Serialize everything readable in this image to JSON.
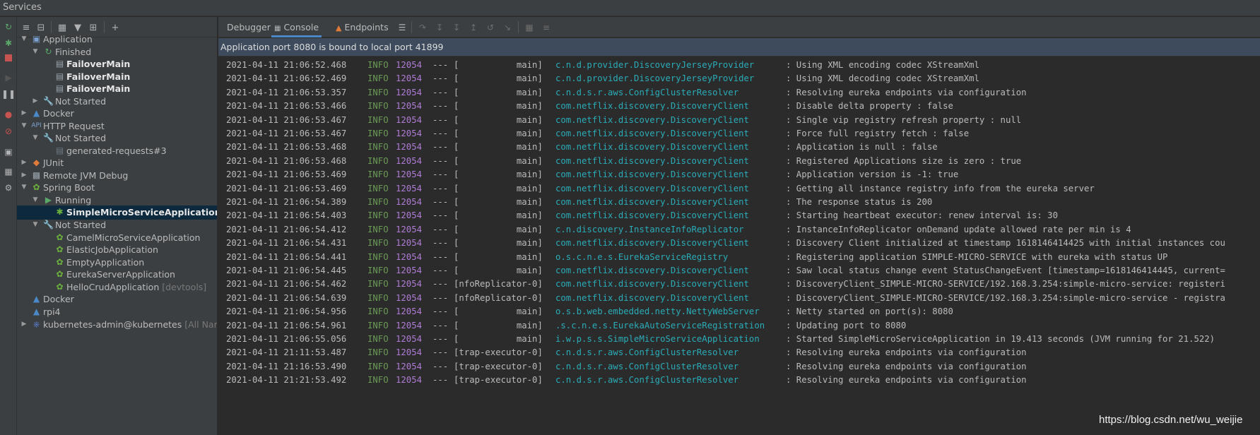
{
  "window": {
    "title": "Services"
  },
  "colors": {
    "accent": "#4a88c7",
    "selected_row": "#0d293e",
    "banner_bg": "#3d4b5c",
    "log_info": "#6a9955",
    "log_pid": "#b07cd6",
    "log_logger": "#2aacb8",
    "run_green": "#59a869",
    "stop_red": "#c75450"
  },
  "left_toolbar": {
    "icons": [
      "rerun-icon",
      "debug-icon",
      "stop-icon",
      "resume-icon",
      "pause-icon",
      "breakpoint-icon",
      "mute-breakpoints-icon",
      "camera-icon",
      "layout-icon",
      "settings-icon"
    ]
  },
  "tree_toolbar": {
    "icons": [
      "expand-all-icon",
      "collapse-all-icon",
      "group-icon",
      "filter-icon",
      "new-tab-icon",
      "add-service-icon"
    ]
  },
  "tree": {
    "items": [
      {
        "label": "Application",
        "suffix": "",
        "bold": false,
        "icon": "application-icon"
      },
      {
        "label": "Finished",
        "suffix": "",
        "bold": false,
        "icon": "finished-icon"
      },
      {
        "label": "FailoverMain",
        "suffix": "",
        "bold": true,
        "icon": "class-icon"
      },
      {
        "label": "FailoverMain",
        "suffix": "",
        "bold": true,
        "icon": "class-icon"
      },
      {
        "label": "FailoverMain",
        "suffix": "",
        "bold": true,
        "icon": "class-icon"
      },
      {
        "label": "Not Started",
        "suffix": "",
        "bold": false,
        "icon": "wrench-icon"
      },
      {
        "label": "Docker",
        "suffix": "",
        "bold": false,
        "icon": "docker-icon"
      },
      {
        "label": "HTTP Request",
        "suffix": "",
        "bold": false,
        "icon": "api-icon"
      },
      {
        "label": "Not Started",
        "suffix": "",
        "bold": false,
        "icon": "wrench-icon"
      },
      {
        "label": "generated-requests#3",
        "suffix": "",
        "bold": false,
        "icon": "http-file-icon"
      },
      {
        "label": "JUnit",
        "suffix": "",
        "bold": false,
        "icon": "junit-icon"
      },
      {
        "label": "Remote JVM Debug",
        "suffix": "",
        "bold": false,
        "icon": "remote-debug-icon"
      },
      {
        "label": "Spring Boot",
        "suffix": "",
        "bold": false,
        "icon": "spring-boot-icon"
      },
      {
        "label": "Running",
        "suffix": "",
        "bold": false,
        "icon": "running-icon"
      },
      {
        "label": "SimpleMicroServiceApplication",
        "suffix": "",
        "bold": true,
        "icon": "spring-debug-icon"
      },
      {
        "label": "Not Started",
        "suffix": "",
        "bold": false,
        "icon": "wrench-icon"
      },
      {
        "label": "CamelMicroServiceApplication",
        "suffix": "",
        "bold": false,
        "icon": "spring-leaf-icon"
      },
      {
        "label": "ElasticJobApplication",
        "suffix": "",
        "bold": false,
        "icon": "spring-leaf-icon"
      },
      {
        "label": "EmptyApplication",
        "suffix": "",
        "bold": false,
        "icon": "spring-leaf-icon"
      },
      {
        "label": "EurekaServerApplication",
        "suffix": "",
        "bold": false,
        "icon": "spring-leaf-icon"
      },
      {
        "label": "HelloCrudApplication",
        "suffix": " [devtools]",
        "bold": false,
        "icon": "spring-leaf-icon"
      },
      {
        "label": "Docker",
        "suffix": "",
        "bold": false,
        "icon": "docker-icon"
      },
      {
        "label": "rpi4",
        "suffix": "",
        "bold": false,
        "icon": "docker-icon"
      },
      {
        "label": "kubernetes-admin@kubernetes",
        "suffix": " [All Nam",
        "bold": false,
        "icon": "kubernetes-icon"
      }
    ]
  },
  "content_toolbar": {
    "tabs": [
      {
        "label": "Debugger",
        "icon": ""
      },
      {
        "label": "Console",
        "icon": "console-icon"
      },
      {
        "label": "Endpoints",
        "icon": "endpoints-icon"
      }
    ],
    "icons": [
      "menu-icon",
      "step-over-icon",
      "step-into-icon",
      "force-step-into-icon",
      "step-out-icon",
      "drop-frame-icon",
      "run-to-cursor-icon",
      "evaluate-icon",
      "trace-icon"
    ]
  },
  "banner": {
    "text": "Application port 8080 is bound to local port 41899"
  },
  "console": {
    "lines": [
      {
        "ts": "2021-04-11 21:06:52.468",
        "level": "INFO",
        "pid": "12054",
        "sep": "---",
        "thread": "[           main]",
        "logger": "c.n.d.provider.DiscoveryJerseyProvider",
        "msg": ": Using XML encoding codec XStreamXml"
      },
      {
        "ts": "2021-04-11 21:06:52.469",
        "level": "INFO",
        "pid": "12054",
        "sep": "---",
        "thread": "[           main]",
        "logger": "c.n.d.provider.DiscoveryJerseyProvider",
        "msg": ": Using XML decoding codec XStreamXml"
      },
      {
        "ts": "2021-04-11 21:06:53.357",
        "level": "INFO",
        "pid": "12054",
        "sep": "---",
        "thread": "[           main]",
        "logger": "c.n.d.s.r.aws.ConfigClusterResolver",
        "msg": ": Resolving eureka endpoints via configuration"
      },
      {
        "ts": "2021-04-11 21:06:53.466",
        "level": "INFO",
        "pid": "12054",
        "sep": "---",
        "thread": "[           main]",
        "logger": "com.netflix.discovery.DiscoveryClient",
        "msg": ": Disable delta property : false"
      },
      {
        "ts": "2021-04-11 21:06:53.467",
        "level": "INFO",
        "pid": "12054",
        "sep": "---",
        "thread": "[           main]",
        "logger": "com.netflix.discovery.DiscoveryClient",
        "msg": ": Single vip registry refresh property : null"
      },
      {
        "ts": "2021-04-11 21:06:53.467",
        "level": "INFO",
        "pid": "12054",
        "sep": "---",
        "thread": "[           main]",
        "logger": "com.netflix.discovery.DiscoveryClient",
        "msg": ": Force full registry fetch : false"
      },
      {
        "ts": "2021-04-11 21:06:53.468",
        "level": "INFO",
        "pid": "12054",
        "sep": "---",
        "thread": "[           main]",
        "logger": "com.netflix.discovery.DiscoveryClient",
        "msg": ": Application is null : false"
      },
      {
        "ts": "2021-04-11 21:06:53.468",
        "level": "INFO",
        "pid": "12054",
        "sep": "---",
        "thread": "[           main]",
        "logger": "com.netflix.discovery.DiscoveryClient",
        "msg": ": Registered Applications size is zero : true"
      },
      {
        "ts": "2021-04-11 21:06:53.469",
        "level": "INFO",
        "pid": "12054",
        "sep": "---",
        "thread": "[           main]",
        "logger": "com.netflix.discovery.DiscoveryClient",
        "msg": ": Application version is -1: true"
      },
      {
        "ts": "2021-04-11 21:06:53.469",
        "level": "INFO",
        "pid": "12054",
        "sep": "---",
        "thread": "[           main]",
        "logger": "com.netflix.discovery.DiscoveryClient",
        "msg": ": Getting all instance registry info from the eureka server"
      },
      {
        "ts": "2021-04-11 21:06:54.389",
        "level": "INFO",
        "pid": "12054",
        "sep": "---",
        "thread": "[           main]",
        "logger": "com.netflix.discovery.DiscoveryClient",
        "msg": ": The response status is 200"
      },
      {
        "ts": "2021-04-11 21:06:54.403",
        "level": "INFO",
        "pid": "12054",
        "sep": "---",
        "thread": "[           main]",
        "logger": "com.netflix.discovery.DiscoveryClient",
        "msg": ": Starting heartbeat executor: renew interval is: 30"
      },
      {
        "ts": "2021-04-11 21:06:54.412",
        "level": "INFO",
        "pid": "12054",
        "sep": "---",
        "thread": "[           main]",
        "logger": "c.n.discovery.InstanceInfoReplicator",
        "msg": ": InstanceInfoReplicator onDemand update allowed rate per min is 4"
      },
      {
        "ts": "2021-04-11 21:06:54.431",
        "level": "INFO",
        "pid": "12054",
        "sep": "---",
        "thread": "[           main]",
        "logger": "com.netflix.discovery.DiscoveryClient",
        "msg": ": Discovery Client initialized at timestamp 1618146414425 with initial instances cou"
      },
      {
        "ts": "2021-04-11 21:06:54.441",
        "level": "INFO",
        "pid": "12054",
        "sep": "---",
        "thread": "[           main]",
        "logger": "o.s.c.n.e.s.EurekaServiceRegistry",
        "msg": ": Registering application SIMPLE-MICRO-SERVICE with eureka with status UP"
      },
      {
        "ts": "2021-04-11 21:06:54.445",
        "level": "INFO",
        "pid": "12054",
        "sep": "---",
        "thread": "[           main]",
        "logger": "com.netflix.discovery.DiscoveryClient",
        "msg": ": Saw local status change event StatusChangeEvent [timestamp=1618146414445, current="
      },
      {
        "ts": "2021-04-11 21:06:54.462",
        "level": "INFO",
        "pid": "12054",
        "sep": "---",
        "thread": "[nfoReplicator-0]",
        "logger": "com.netflix.discovery.DiscoveryClient",
        "msg": ": DiscoveryClient_SIMPLE-MICRO-SERVICE/192.168.3.254:simple-micro-service: registeri"
      },
      {
        "ts": "2021-04-11 21:06:54.639",
        "level": "INFO",
        "pid": "12054",
        "sep": "---",
        "thread": "[nfoReplicator-0]",
        "logger": "com.netflix.discovery.DiscoveryClient",
        "msg": ": DiscoveryClient_SIMPLE-MICRO-SERVICE/192.168.3.254:simple-micro-service - registra"
      },
      {
        "ts": "2021-04-11 21:06:54.956",
        "level": "INFO",
        "pid": "12054",
        "sep": "---",
        "thread": "[           main]",
        "logger": "o.s.b.web.embedded.netty.NettyWebServer",
        "msg": ": Netty started on port(s): 8080"
      },
      {
        "ts": "2021-04-11 21:06:54.961",
        "level": "INFO",
        "pid": "12054",
        "sep": "---",
        "thread": "[           main]",
        "logger": ".s.c.n.e.s.EurekaAutoServiceRegistration",
        "msg": ": Updating port to 8080"
      },
      {
        "ts": "2021-04-11 21:06:55.056",
        "level": "INFO",
        "pid": "12054",
        "sep": "---",
        "thread": "[           main]",
        "logger": "i.w.p.s.s.SimpleMicroServiceApplication",
        "msg": ": Started SimpleMicroServiceApplication in 19.413 seconds (JVM running for 21.522)"
      },
      {
        "ts": "2021-04-11 21:11:53.487",
        "level": "INFO",
        "pid": "12054",
        "sep": "---",
        "thread": "[trap-executor-0]",
        "logger": "c.n.d.s.r.aws.ConfigClusterResolver",
        "msg": ": Resolving eureka endpoints via configuration"
      },
      {
        "ts": "2021-04-11 21:16:53.490",
        "level": "INFO",
        "pid": "12054",
        "sep": "---",
        "thread": "[trap-executor-0]",
        "logger": "c.n.d.s.r.aws.ConfigClusterResolver",
        "msg": ": Resolving eureka endpoints via configuration"
      },
      {
        "ts": "2021-04-11 21:21:53.492",
        "level": "INFO",
        "pid": "12054",
        "sep": "---",
        "thread": "[trap-executor-0]",
        "logger": "c.n.d.s.r.aws.ConfigClusterResolver",
        "msg": ": Resolving eureka endpoints via configuration"
      }
    ]
  },
  "watermark": {
    "text": "https://blog.csdn.net/wu_weijie"
  }
}
